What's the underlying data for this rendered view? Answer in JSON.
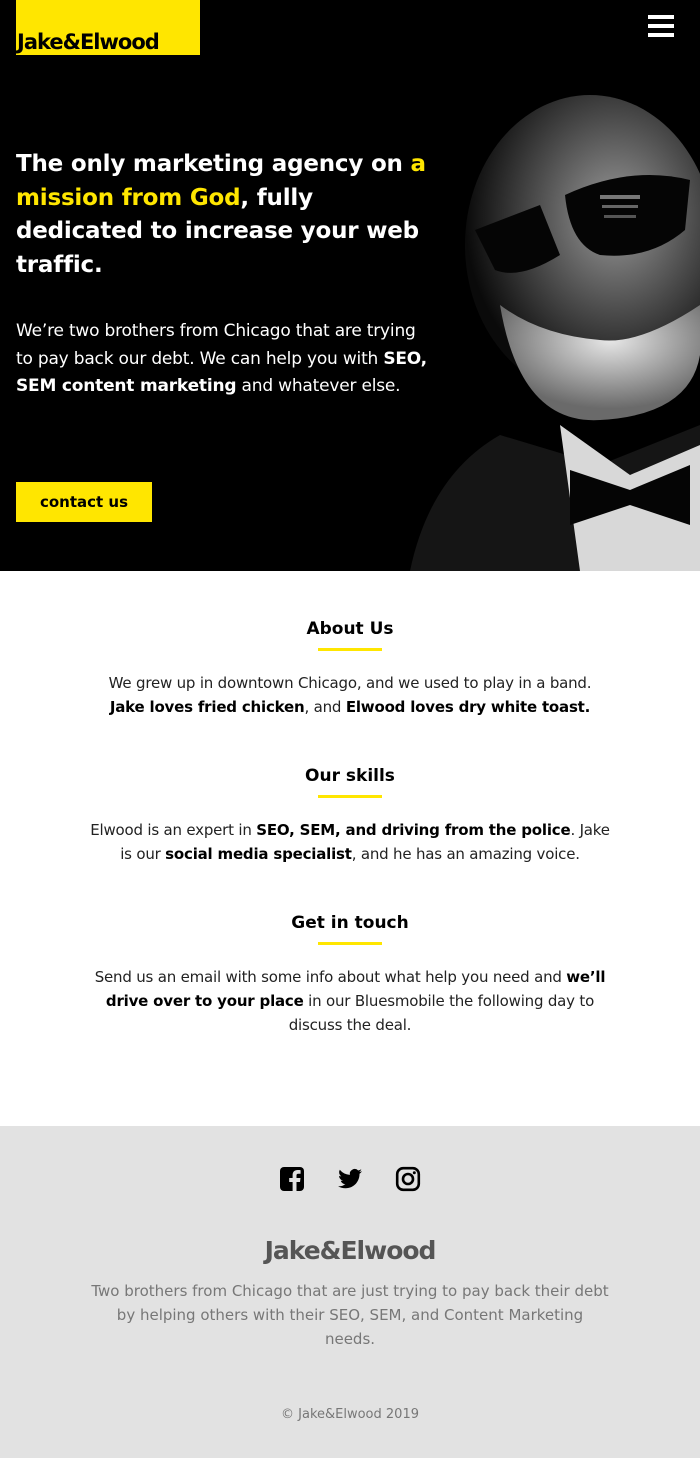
{
  "brand": {
    "logo_text": "Jake&Elwood",
    "accent_color": "#ffe600"
  },
  "header": {
    "menu_icon": "hamburger-menu-icon"
  },
  "hero": {
    "title_part1": "The only marketing agency on ",
    "title_highlight": "a mission from God",
    "title_part2": ", fully dedicated to increase your web traffic.",
    "text_part1": "We’re two brothers from Chicago that are trying to pay back our debt. We can help you with ",
    "text_bold": "SEO, SEM content marketing",
    "text_part2": " and whatever else.",
    "cta_label": "contact us"
  },
  "about": {
    "heading": "About Us",
    "text_part1": "We grew up in downtown Chicago, and we used to play in a band. ",
    "bold1": "Jake loves fried chicken",
    "text_part2": ", and ",
    "bold2": "Elwood loves dry white toast."
  },
  "skills": {
    "heading": "Our skills",
    "text_part1": "Elwood is an expert in ",
    "bold1": "SEO, SEM, and driving from the police",
    "text_part2": ". Jake is our ",
    "bold2": "social media specialist",
    "text_part3": ", and he has an amazing voice."
  },
  "contact": {
    "heading": "Get in touch",
    "text_part1": "Send us an email with some info about what help you need and ",
    "bold1": "we’ll drive over to your place",
    "text_part2": " in our Bluesmobile the following day to discuss the deal."
  },
  "footer": {
    "social_icons": [
      "facebook-icon",
      "twitter-icon",
      "instagram-icon"
    ],
    "logo_text": "Jake&Elwood",
    "description": "Two brothers from Chicago that are just trying to pay back their debt by helping others with their SEO, SEM, and Content Marketing needs.",
    "copyright": "© Jake&Elwood 2019"
  }
}
